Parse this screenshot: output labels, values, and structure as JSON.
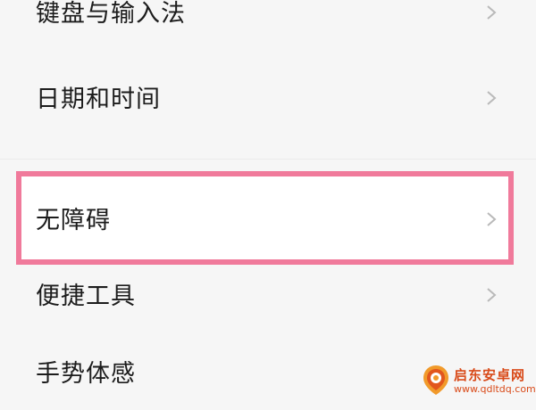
{
  "settings_list": {
    "items": [
      {
        "label": "键盘与输入法",
        "chevron": "chevron-right-icon"
      },
      {
        "label": "日期和时间",
        "chevron": "chevron-right-icon"
      },
      {
        "label": "无障碍",
        "chevron": "chevron-right-icon",
        "highlighted": true
      },
      {
        "label": "便捷工具",
        "chevron": "chevron-right-icon"
      },
      {
        "label": "手势体感",
        "chevron": "chevron-right-icon"
      }
    ]
  },
  "highlight": {
    "color": "#f07a9b"
  },
  "watermark": {
    "title": "启东安卓网",
    "url": "www.qdltdq.com",
    "color": "#d94b1a"
  },
  "colors": {
    "background": "#f6f6f6",
    "text": "#1c1c1c",
    "chevron": "#b9b9b9"
  }
}
